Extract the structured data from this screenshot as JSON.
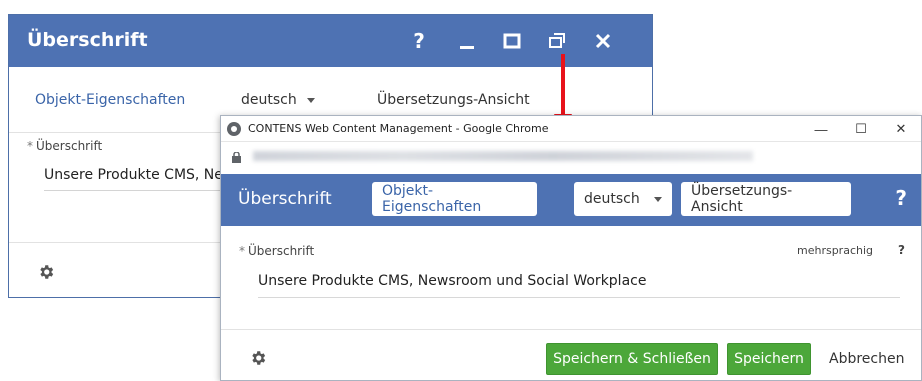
{
  "background_dialog": {
    "title": "Überschrift",
    "header_icons": [
      "help-icon",
      "minimize-icon",
      "maximize-icon",
      "popout-icon",
      "close-icon"
    ],
    "help_glyph": "?",
    "tabs": [
      {
        "label": "Objekt-Eigenschaften",
        "active": true
      },
      {
        "label": "deutsch",
        "dropdown": true
      },
      {
        "label": "Übersetzungs-Ansicht"
      }
    ],
    "field": {
      "required_mark": "*",
      "label": "Überschrift",
      "value": "Unsere Produkte CMS, Newsroom und Social Workplace"
    },
    "footer_icon": "gear-icon"
  },
  "chrome_window": {
    "title": "CONTENS Web Content Management - Google Chrome",
    "controls": {
      "minimize": "—",
      "maximize": "☐",
      "close": "✕"
    },
    "url_obscured": true
  },
  "popup_dialog": {
    "title": "Überschrift",
    "tabs": [
      {
        "label": "Objekt-Eigenschaften",
        "active": true
      },
      {
        "label": "deutsch",
        "dropdown": true
      },
      {
        "label": "Übersetzungs-Ansicht"
      }
    ],
    "help_glyph": "?",
    "field": {
      "required_mark": "*",
      "label": "Überschrift",
      "multilang_label": "mehrsprachig",
      "multilang_help": "?",
      "value": "Unsere Produkte CMS, Newsroom und Social Workplace"
    },
    "buttons": {
      "save_close": "Speichern & Schließen",
      "save": "Speichern",
      "cancel": "Abbrechen"
    }
  },
  "colors": {
    "header_blue": "#4e72b3",
    "active_tab_blue": "#3a64a8",
    "button_green": "#4ca73a",
    "arrow_red": "#e8121b"
  }
}
